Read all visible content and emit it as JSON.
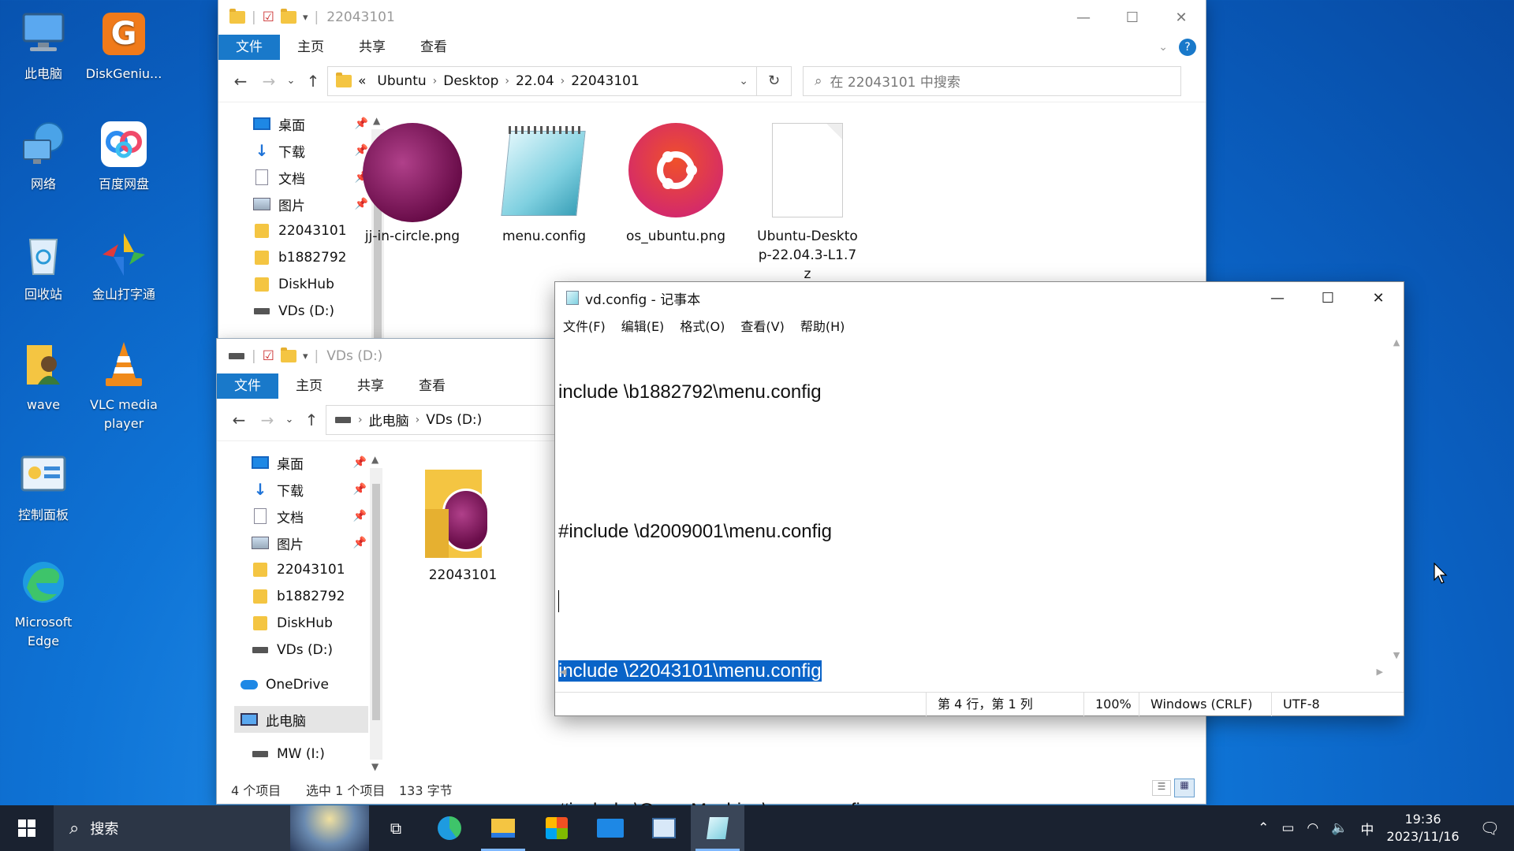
{
  "desktop": {
    "icons": [
      {
        "label": "此电脑",
        "icon": "this-pc-icon"
      },
      {
        "label": "DiskGeniu...",
        "icon": "diskgenius-icon"
      },
      {
        "label": "网络",
        "icon": "network-icon"
      },
      {
        "label": "百度网盘",
        "icon": "baidu-netdisk-icon"
      },
      {
        "label": "回收站",
        "icon": "recycle-bin-icon"
      },
      {
        "label": "金山打字通",
        "icon": "kingsoft-typing-icon"
      },
      {
        "label": "wave",
        "icon": "wave-user-folder-icon"
      },
      {
        "label": "VLC media player",
        "icon": "vlc-icon"
      },
      {
        "label": "控制面板",
        "icon": "control-panel-icon"
      },
      {
        "label": "Microsoft Edge",
        "icon": "edge-icon"
      }
    ]
  },
  "explorer1": {
    "title": "22043101",
    "tabs": [
      "文件",
      "主页",
      "共享",
      "查看"
    ],
    "path": [
      "«",
      "Ubuntu",
      "Desktop",
      "22.04",
      "22043101"
    ],
    "search_placeholder": "在 22043101 中搜索",
    "nav": [
      "桌面",
      "下载",
      "文档",
      "图片",
      "22043101",
      "b1882792",
      "DiskHub",
      "VDs (D:)"
    ],
    "files": [
      "jj-in-circle.png",
      "menu.config",
      "os_ubuntu.png",
      "Ubuntu-Desktop-22.04.3-L1.7z"
    ]
  },
  "explorer2": {
    "title": "VDs (D:)",
    "tabs": [
      "文件",
      "主页",
      "共享",
      "查看"
    ],
    "path": [
      "此电脑",
      "VDs (D:)"
    ],
    "nav": [
      "桌面",
      "下载",
      "文档",
      "图片",
      "22043101",
      "b1882792",
      "DiskHub",
      "VDs (D:)",
      "OneDrive",
      "此电脑",
      "MW (I:)"
    ],
    "files": [
      "22043101"
    ],
    "status": {
      "count": "4 个项目",
      "selected": "选中 1 个项目",
      "size": "133 字节"
    }
  },
  "notepad": {
    "title": "vd.config - 记事本",
    "menu": [
      "文件(F)",
      "编辑(E)",
      "格式(O)",
      "查看(V)",
      "帮助(H)"
    ],
    "lines": [
      "include \\b1882792\\menu.config",
      "",
      "#include \\d2009001\\menu.config",
      "",
      "include \\22043101\\menu.config",
      "",
      "#include \\GameMachine\\menu.config"
    ],
    "status": {
      "pos": "第 4 行，第 1 列",
      "zoom": "100%",
      "eol": "Windows (CRLF)",
      "enc": "UTF-8"
    }
  },
  "taskbar": {
    "search_label": "搜索",
    "ime": "中",
    "time": "19:36",
    "date": "2023/11/16"
  }
}
